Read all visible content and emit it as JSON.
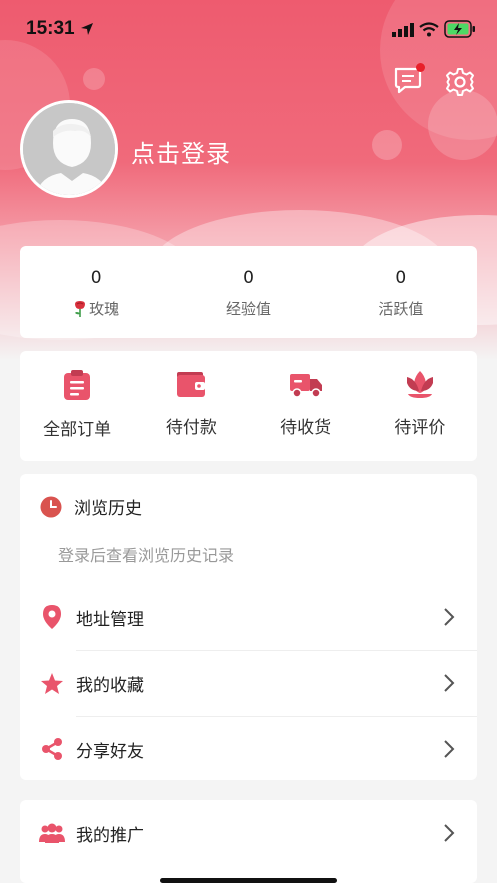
{
  "status_bar": {
    "time": "15:31"
  },
  "header": {
    "login_text": "点击登录"
  },
  "stats": [
    {
      "value": "0",
      "label": "玫瑰"
    },
    {
      "value": "0",
      "label": "经验值"
    },
    {
      "value": "0",
      "label": "活跃值"
    }
  ],
  "orders": [
    {
      "label": "全部订单",
      "icon": "clipboard-icon"
    },
    {
      "label": "待付款",
      "icon": "wallet-icon"
    },
    {
      "label": "待收货",
      "icon": "truck-icon"
    },
    {
      "label": "待评价",
      "icon": "lotus-icon"
    }
  ],
  "history": {
    "title": "浏览历史",
    "empty_text": "登录后查看浏览历史记录"
  },
  "menu": [
    {
      "label": "地址管理",
      "icon": "location-pin-icon"
    },
    {
      "label": "我的收藏",
      "icon": "star-icon"
    },
    {
      "label": "分享好友",
      "icon": "share-icon"
    }
  ],
  "promo": {
    "label": "我的推广",
    "icon": "people-icon"
  },
  "colors": {
    "accent": "#ee5b6f",
    "icon_red": "#e9546b"
  }
}
